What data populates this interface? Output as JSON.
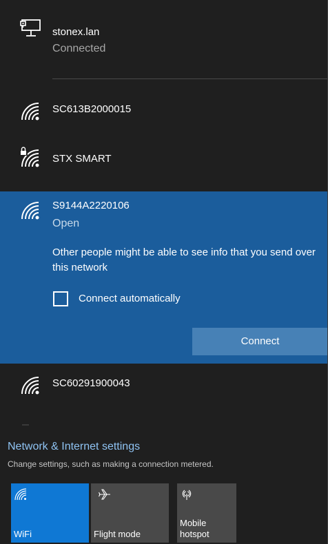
{
  "connected_network": {
    "name": "stonex.lan",
    "status": "Connected",
    "icon": "ethernet-icon"
  },
  "networks": [
    {
      "name": "SC613B2000015",
      "icon": "wifi-signal-icon",
      "secured": false
    },
    {
      "name": "STX SMART",
      "icon": "wifi-secured-icon",
      "secured": true
    },
    {
      "name": "SC60291900043",
      "icon": "wifi-signal-icon",
      "secured": false
    }
  ],
  "selected_network": {
    "name": "S9144A2220106",
    "status": "Open",
    "icon": "wifi-signal-icon",
    "warning": "Other people might be able to see info that you send over this network",
    "auto_connect_label": "Connect automatically",
    "auto_connect_checked": false,
    "connect_label": "Connect"
  },
  "settings": {
    "link": "Network & Internet settings",
    "description": "Change settings, such as making a connection metered."
  },
  "quick_actions": [
    {
      "label": "WiFi",
      "icon": "wifi-icon",
      "active": true
    },
    {
      "label": "Flight mode",
      "icon": "airplane-icon",
      "active": false
    },
    {
      "label": "Mobile hotspot",
      "icon": "hotspot-icon",
      "active": false
    }
  ],
  "colors": {
    "background": "#1f1f1f",
    "selected_background": "#1b5d9c",
    "connect_button": "#4781b6",
    "link": "#8fc3f3",
    "active_tile": "#0f78d4",
    "inactive_tile": "#494949"
  }
}
